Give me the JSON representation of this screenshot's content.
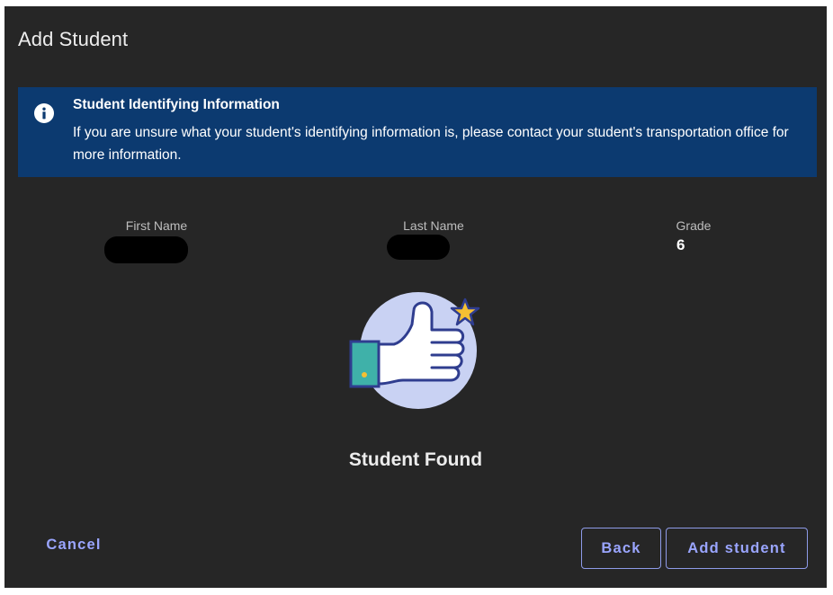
{
  "dialog": {
    "title": "Add Student"
  },
  "banner": {
    "icon": "info-icon",
    "title": "Student Identifying Information",
    "text": "If you are unsure what your student's identifying information is, please contact your student's transportation office for more information."
  },
  "fields": {
    "first_name_label": "First Name",
    "last_name_label": "Last Name",
    "grade_label": "Grade",
    "grade_value": "6"
  },
  "illustration": {
    "icon": "thumbs-up-star-icon"
  },
  "status": {
    "text": "Student Found"
  },
  "actions": {
    "cancel_label": "Cancel",
    "back_label": "Back",
    "add_label": "Add student"
  },
  "colors": {
    "dialog_bg": "#262626",
    "banner_bg": "#0c3a70",
    "accent": "#9aa5ff"
  }
}
